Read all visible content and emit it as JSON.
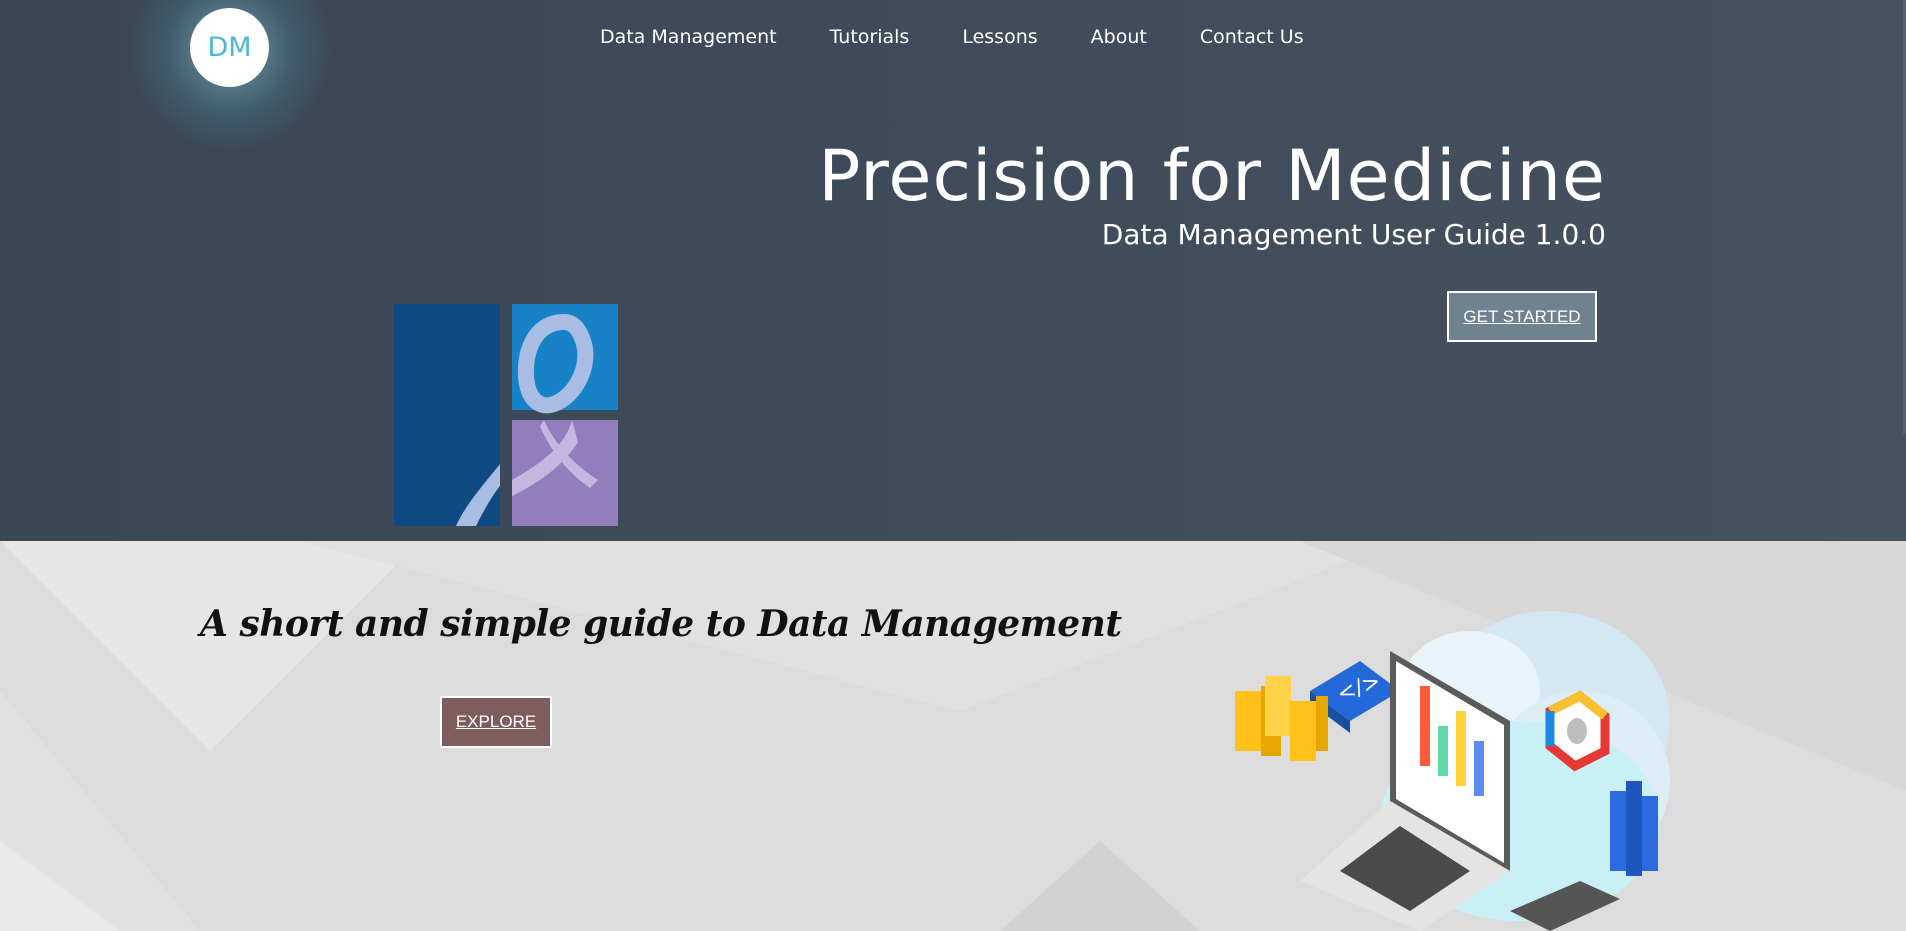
{
  "header": {
    "logo_text": "DM",
    "nav": [
      {
        "label": "Data Management"
      },
      {
        "label": "Tutorials"
      },
      {
        "label": "Lessons"
      },
      {
        "label": "About"
      },
      {
        "label": "Contact Us"
      }
    ]
  },
  "hero": {
    "title": "Precision for Medicine",
    "subtitle": "Data Management User Guide 1.0.0",
    "cta_label": "GET STARTED"
  },
  "intro": {
    "tagline": "A short and simple guide to Data Management",
    "cta_label": "EXPLORE"
  },
  "icons": {
    "logo": "ribbon-logo-icon",
    "illustration": "cloud-data-analytics-icon"
  },
  "colors": {
    "hero_bg": "#3f4b5a",
    "logo_text": "#4ab8d9",
    "get_started_bg": "#6e838f",
    "explore_bg": "#7f5d5d",
    "section_bg": "#dcdcdc"
  }
}
